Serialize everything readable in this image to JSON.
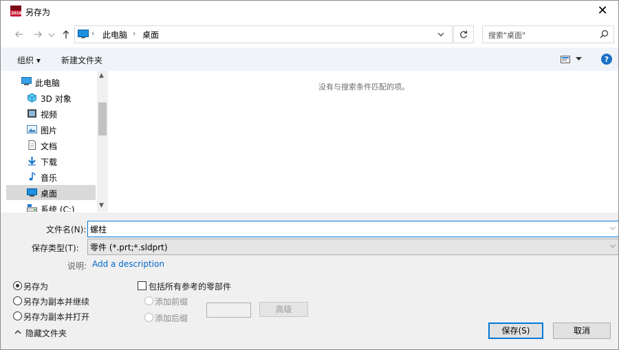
{
  "window": {
    "title": "另存为",
    "app_badge": "2016"
  },
  "address": {
    "path": [
      "此电脑",
      "桌面"
    ],
    "search_placeholder": "搜索\"桌面\""
  },
  "toolbar": {
    "organize_label": "组织 ▾",
    "new_folder_label": "新建文件夹"
  },
  "nav_pane": {
    "items": [
      {
        "label": "此电脑",
        "icon": "computer-icon"
      },
      {
        "label": "3D 对象",
        "icon": "cube-3d-icon"
      },
      {
        "label": "视频",
        "icon": "video-icon"
      },
      {
        "label": "图片",
        "icon": "picture-icon"
      },
      {
        "label": "文档",
        "icon": "document-icon"
      },
      {
        "label": "下载",
        "icon": "download-icon"
      },
      {
        "label": "音乐",
        "icon": "music-icon"
      },
      {
        "label": "桌面",
        "icon": "desktop-icon"
      },
      {
        "label": "系统 (C:)",
        "icon": "drive-icon"
      }
    ],
    "selected": "桌面"
  },
  "file_pane": {
    "empty_message": "没有与搜索条件匹配的项。"
  },
  "form": {
    "filename_label": "文件名(N):",
    "filename_value": "螺柱",
    "filetype_label": "保存类型(T):",
    "filetype_value": "零件 (*.prt;*.sldprt)",
    "description_label": "说明:",
    "description_link": "Add a description"
  },
  "options": {
    "radio_save_as": "另存为",
    "radio_save_copy_continue": "另存为副本并继续",
    "radio_save_copy_open": "另存为副本并打开",
    "checkbox_include_refs": "包括所有参考的零部件",
    "radio_add_prefix": "添加前缀",
    "radio_add_suffix": "添加后缀",
    "advanced_button": "高级",
    "selected_radio": "另存为"
  },
  "footer": {
    "hide_folders": "隐藏文件夹",
    "save_button": "保存(S)",
    "cancel_button": "取消"
  },
  "colors": {
    "accent": "#0078d7",
    "link": "#0066cc",
    "help_icon": "#1a6fc6",
    "brand": "#c8102e"
  }
}
